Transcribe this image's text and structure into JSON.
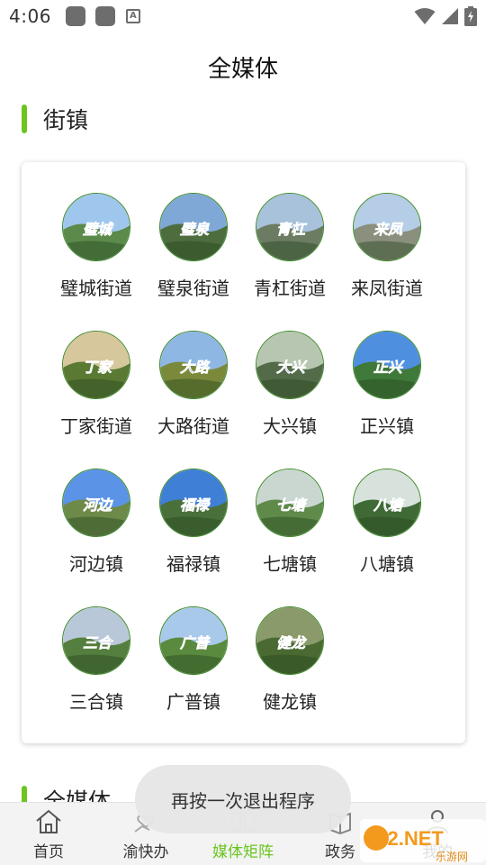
{
  "status_bar": {
    "time": "4:06",
    "notif_icons": [
      "app-notif-icon",
      "app-notif-icon",
      "a-badge-icon"
    ],
    "notif_a_letter": "A"
  },
  "page": {
    "title": "全媒体"
  },
  "section": {
    "title": "街镇"
  },
  "section_next": {
    "title": "全媒体"
  },
  "towns": [
    {
      "name": "璧城街道",
      "badge": "璧城",
      "sky": "#9fc7ee",
      "ground": "#5c8a4b"
    },
    {
      "name": "璧泉街道",
      "badge": "璧泉",
      "sky": "#7fa8d6",
      "ground": "#4d6d3f"
    },
    {
      "name": "青杠街道",
      "badge": "青杠",
      "sky": "#a8c2dc",
      "ground": "#6b7c62"
    },
    {
      "name": "来凤街道",
      "badge": "来凤",
      "sky": "#b5cde6",
      "ground": "#8a8f7e"
    },
    {
      "name": "丁家街道",
      "badge": "丁家",
      "sky": "#d6c79d",
      "ground": "#5a7a34"
    },
    {
      "name": "大路街道",
      "badge": "大路",
      "sky": "#8fb7e4",
      "ground": "#7b8a3a"
    },
    {
      "name": "大兴镇",
      "badge": "大兴",
      "sky": "#b7c6b0",
      "ground": "#546b4a"
    },
    {
      "name": "正兴镇",
      "badge": "正兴",
      "sky": "#4f8fe0",
      "ground": "#3f7a3a"
    },
    {
      "name": "河边镇",
      "badge": "河边",
      "sky": "#5b93e6",
      "ground": "#6e8a49"
    },
    {
      "name": "福禄镇",
      "badge": "福禄",
      "sky": "#3f7fd6",
      "ground": "#49703a"
    },
    {
      "name": "七塘镇",
      "badge": "七塘",
      "sky": "#c9d7d0",
      "ground": "#5f8a4a"
    },
    {
      "name": "八塘镇",
      "badge": "八塘",
      "sky": "#d8e2dc",
      "ground": "#3f6a35"
    },
    {
      "name": "三合镇",
      "badge": "三合",
      "sky": "#b9c8d8",
      "ground": "#557f3e"
    },
    {
      "name": "广普镇",
      "badge": "广普",
      "sky": "#a9c9ea",
      "ground": "#5a8a3e"
    },
    {
      "name": "健龙镇",
      "badge": "健龙",
      "sky": "#8a9a6a",
      "ground": "#4a6a32"
    }
  ],
  "bottom_nav": [
    {
      "label": "首页",
      "icon": "home-icon",
      "active": false
    },
    {
      "label": "渝快办",
      "icon": "heart-hand-icon",
      "active": false
    },
    {
      "label": "媒体矩阵",
      "icon": "grid-icon",
      "active": true
    },
    {
      "label": "政务",
      "icon": "book-icon",
      "active": false
    },
    {
      "label": "我的",
      "icon": "person-icon",
      "active": false
    }
  ],
  "toast": {
    "text": "再按一次退出程序"
  },
  "watermark": {
    "text": "962.NET",
    "subtext": "乐游网"
  },
  "colors": {
    "accent": "#6cc51f",
    "badge_text": "#1f4fa8"
  }
}
